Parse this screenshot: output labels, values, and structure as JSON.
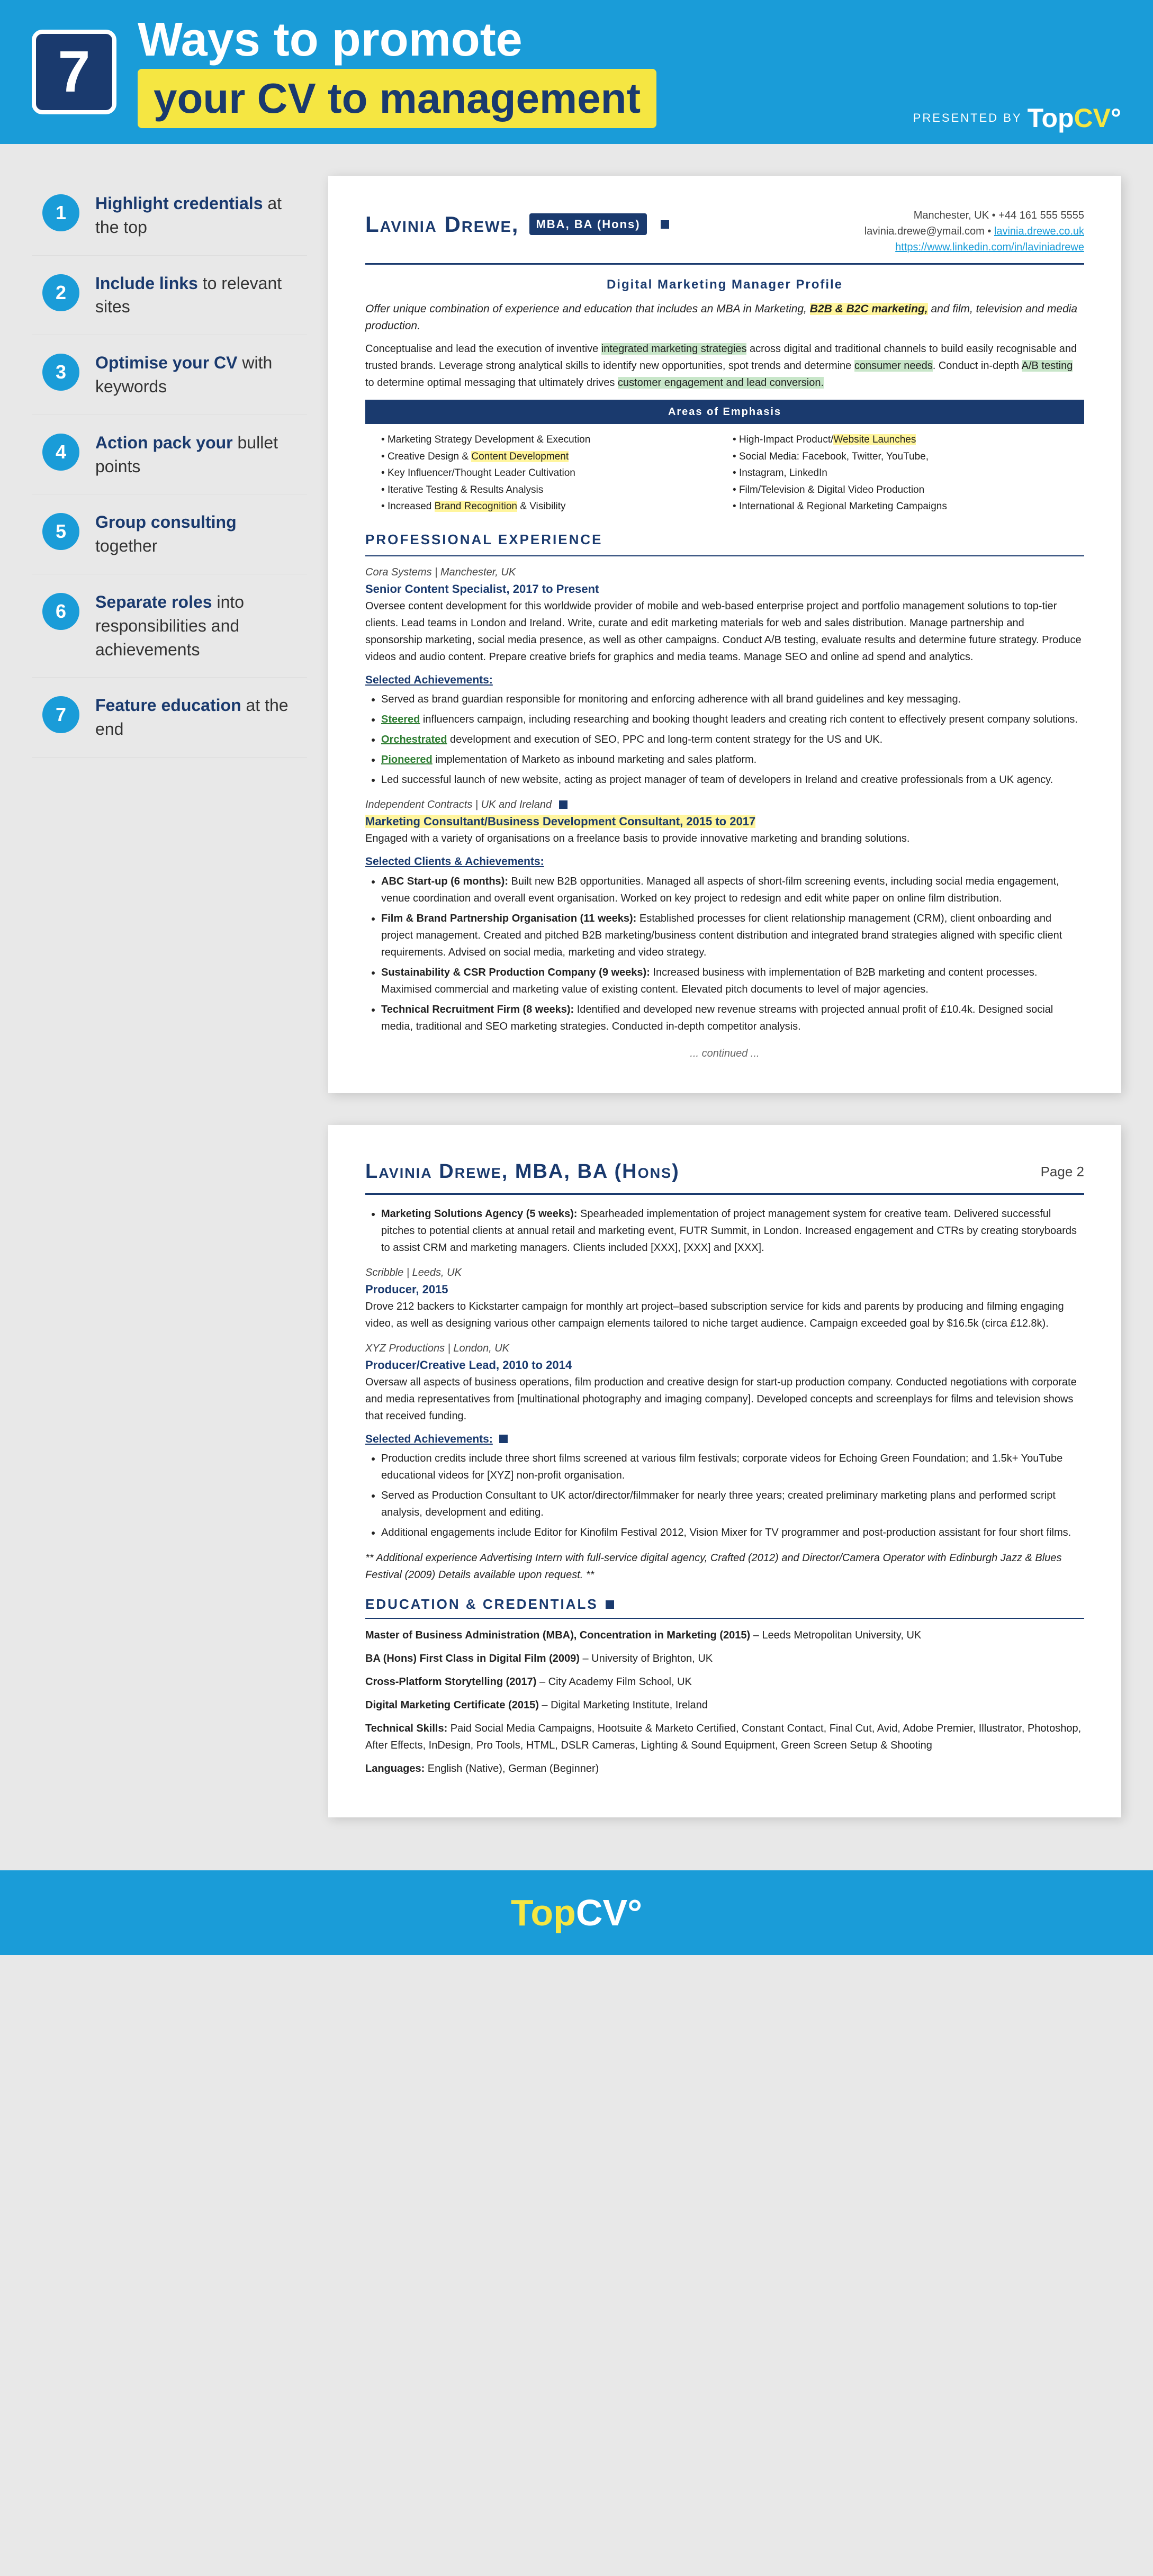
{
  "header": {
    "number": "7",
    "title_line1": "Ways to promote",
    "title_line2": "your CV to management",
    "presented_by": "PRESENTED BY",
    "logo": "TopCV"
  },
  "sidebar": {
    "items": [
      {
        "number": "1",
        "label_bold": "Highlight credentials",
        "label_rest": " at the top"
      },
      {
        "number": "2",
        "label_bold": "Include links",
        "label_rest": " to relevant sites"
      },
      {
        "number": "3",
        "label_bold": "Optimise your CV",
        "label_rest": " with keywords"
      },
      {
        "number": "4",
        "label_bold": "Action pack your",
        "label_rest": " bullet points"
      },
      {
        "number": "5",
        "label_bold": "Group consulting",
        "label_rest": " together"
      },
      {
        "number": "6",
        "label_bold": "Separate roles",
        "label_rest": " into responsibilities and achievements"
      },
      {
        "number": "7",
        "label_bold": "Feature education",
        "label_rest": " at the end"
      }
    ]
  },
  "cv_page1": {
    "name": "Lavinia Drewe,",
    "credentials": "MBA, BA (Hons)",
    "contact_location": "Manchester, UK • +44 161 555 5555",
    "contact_email": "lavinia.drewe@ymail.com •",
    "contact_email_link": "lavinia.drewe.co.uk",
    "contact_linkedin": "https://www.linkedin.com/in/laviniadrewe",
    "profile_title": "Digital Marketing Manager Profile",
    "profile_intro": "Offer unique combination of experience and education that includes an MBA in Marketing, B2B & B2C marketing, and film, television and media production.",
    "profile_body": "Conceptualise and lead the execution of inventive integrated marketing strategies across digital and traditional channels to build easily recognisable and trusted brands. Leverage strong analytical skills to identify new opportunities, spot trends and determine consumer needs. Conduct in-depth A/B testing to determine optimal messaging that ultimately drives customer engagement and lead conversion.",
    "areas_title": "Areas of Emphasis",
    "areas": [
      "Marketing Strategy Development & Execution",
      "High-Impact Product/Website Launches",
      "Creative Design & Content Development",
      "Social Media: Facebook, Twitter, YouTube,",
      "Key Influencer/Thought Leader Cultivation",
      "Instagram, LinkedIn",
      "Iterative Testing & Results Analysis",
      "Film/Television & Digital Video Production",
      "Increased Brand Recognition & Visibility",
      "International & Regional Marketing Campaigns"
    ],
    "exp_title": "Professional Experience",
    "job1_company": "Cora Systems | Manchester, UK",
    "job1_title": "Senior Content Specialist, 2017 to Present",
    "job1_body": "Oversee content development for this worldwide provider of mobile and web-based enterprise project and portfolio management solutions to top-tier clients. Lead teams in London and Ireland. Write, curate and edit marketing materials for web and sales distribution. Manage partnership and sponsorship marketing, social media presence, as well as other campaigns. Conduct A/B testing, evaluate results and determine future strategy. Produce videos and audio content. Prepare creative briefs for graphics and media teams. Manage SEO and online ad spend and analytics.",
    "job1_achievements_label": "Selected Achievements:",
    "job1_achievements": [
      "Served as brand guardian responsible for monitoring and enforcing adherence with all brand guidelines and key messaging.",
      "Steered influencers campaign, including researching and booking thought leaders and creating rich content to effectively present company solutions.",
      "Orchestrated development and execution of SEO, PPC and long-term content strategy for the US and UK.",
      "Pioneered implementation of Marketo as inbound marketing and sales platform.",
      "Led successful launch of new website, acting as project manager of team of developers in Ireland and creative professionals from a UK agency."
    ],
    "job2_region": "Independent Contracts | UK and Ireland",
    "job2_title": "Marketing Consultant/Business Development Consultant, 2015 to 2017",
    "job2_intro": "Engaged with a variety of organisations on a freelance basis to provide innovative marketing and branding solutions.",
    "job2_clients_label": "Selected Clients & Achievements:",
    "job2_clients": [
      "ABC Start-up (6 months): Built new B2B opportunities. Managed all aspects of short-film screening events, including social media engagement, venue coordination and overall event organisation. Worked on key project to redesign and edit white paper on online film distribution.",
      "Film & Brand Partnership Organisation (11 weeks): Established processes for client relationship management (CRM), client onboarding and project management. Created and pitched B2B marketing/business content distribution and integrated brand strategies aligned with specific client requirements. Advised on social media, marketing and video strategy.",
      "Sustainability & CSR Production Company (9 weeks): Increased business with implementation of B2B marketing and content processes. Maximised commercial and marketing value of existing content. Elevated pitch documents to level of major agencies.",
      "Technical Recruitment Firm (8 weeks): Identified and developed new revenue streams with projected annual profit of £10.4k. Designed social media, traditional and SEO marketing strategies. Conducted in-depth competitor analysis."
    ],
    "continued": "... continued ..."
  },
  "cv_page2": {
    "name": "Lavinia Drewe, MBA, BA (Hons)",
    "page_label": "Page 2",
    "job3_clients": [
      "Marketing Solutions Agency (5 weeks): Spearheaded implementation of project management system for creative team. Delivered successful pitches to potential clients at annual retail and marketing event, FUTR Summit, in London. Increased engagement and CTRs by creating storyboards to assist CRM and marketing managers. Clients included [XXX], [XXX] and [XXX]."
    ],
    "job4_company": "Scribble | Leeds, UK",
    "job4_title": "Producer, 2015",
    "job4_body": "Drove 212 backers to Kickstarter campaign for monthly art project–based subscription service for kids and parents by producing and filming engaging video, as well as designing various other campaign elements tailored to niche target audience. Campaign exceeded goal by $16.5k (circa £12.8k).",
    "job5_company": "XYZ Productions | London, UK",
    "job5_title": "Producer/Creative Lead, 2010 to 2014",
    "job5_body": "Oversaw all aspects of business operations, film production and creative design for start-up production company. Conducted negotiations with corporate and media representatives from [multinational photography and imaging company]. Developed concepts and screenplays for films and television shows that received funding.",
    "job5_achievements_label": "Selected Achievements:",
    "job5_achievements": [
      "Production credits include three short films screened at various film festivals; corporate videos for Echoing Green Foundation; and 1.5k+ YouTube educational videos for [XYZ] non-profit organisation.",
      "Served as Production Consultant to UK actor/director/filmmaker for nearly three years; created preliminary marketing plans and performed script analysis, development and editing.",
      "Additional engagements include Editor for Kinofilm Festival 2012, Vision Mixer for TV programmer and post-production assistant for four short films."
    ],
    "additional_note": "** Additional experience Advertising Intern with full-service digital agency, Crafted (2012) and Director/Camera Operator with Edinburgh Jazz & Blues Festival (2009) Details available upon request. **",
    "edu_title": "Education & Credentials",
    "edu_items": [
      "Master of Business Administration (MBA), Concentration in Marketing (2015) – Leeds Metropolitan University, UK",
      "BA (Hons) First Class in Digital Film (2009) – University of Brighton, UK",
      "Cross-Platform Storytelling (2017) – City Academy Film School, UK",
      "Digital Marketing Certificate (2015) – Digital Marketing Institute, Ireland",
      "Technical Skills: Paid Social Media Campaigns, Hootsuite & Marketo Certified, Constant Contact, Final Cut, Avid, Adobe Premier, Illustrator, Photoshop, After Effects, InDesign, Pro Tools, HTML, DSLR Cameras, Lighting & Sound Equipment, Green Screen Setup & Shooting",
      "Languages: English (Native), German (Beginner)"
    ]
  },
  "footer": {
    "logo_top": "Top",
    "logo_cv": "CV"
  }
}
